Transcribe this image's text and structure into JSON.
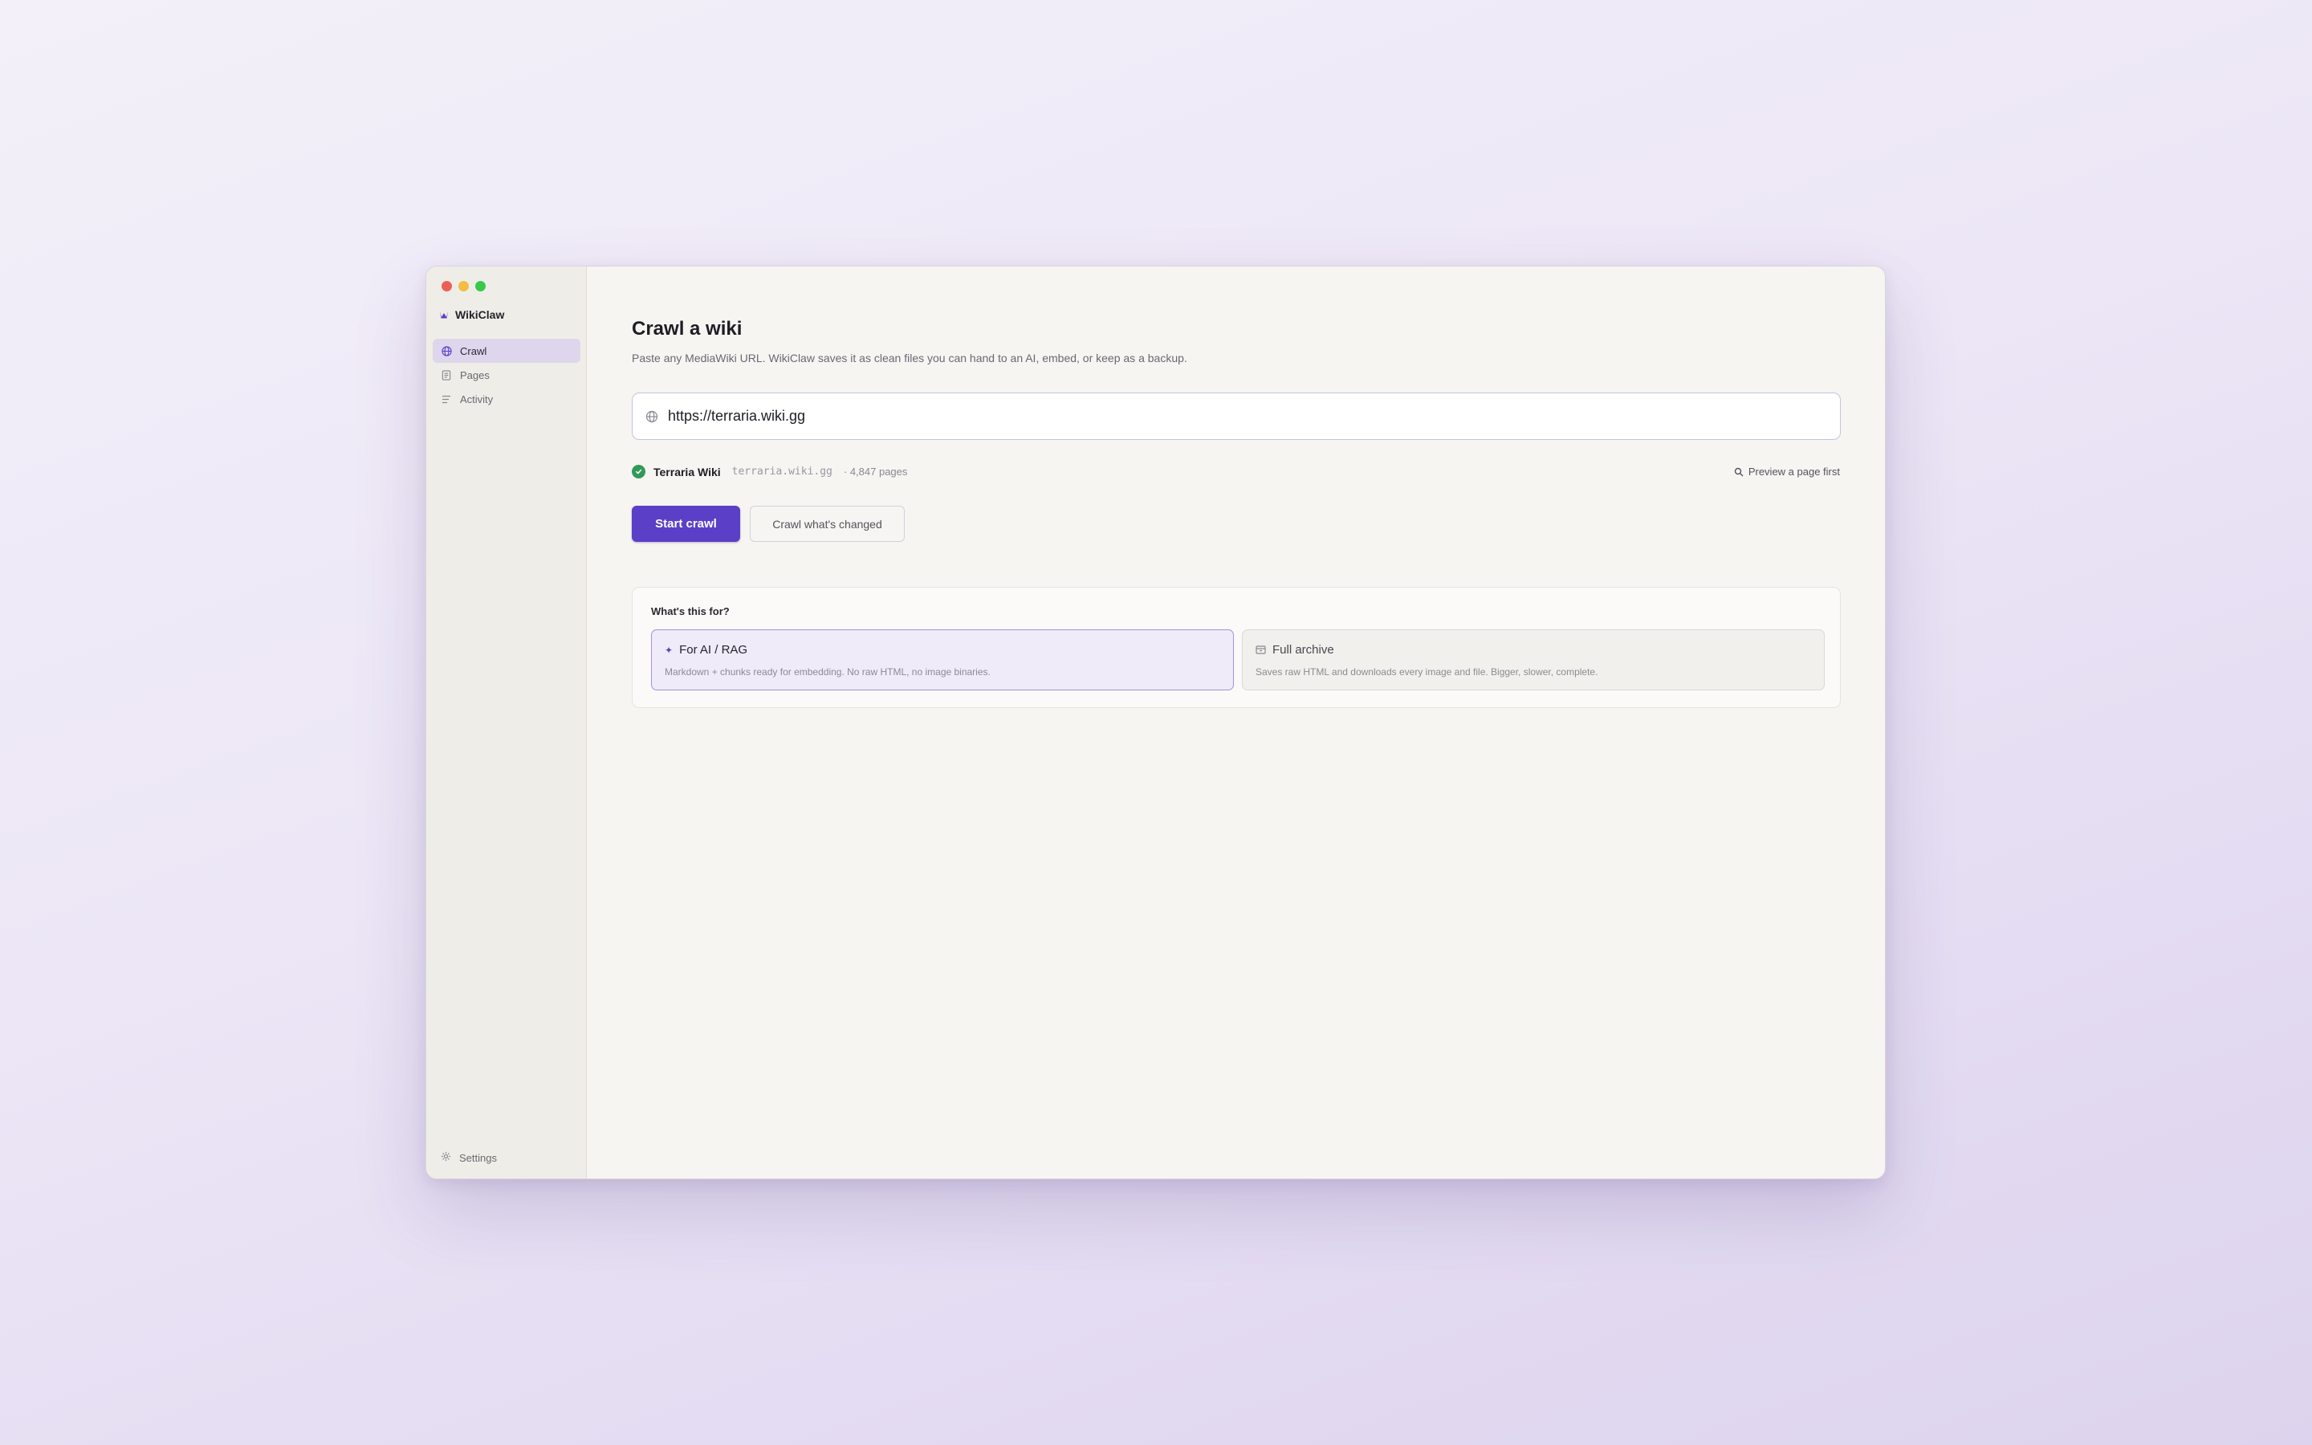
{
  "app": {
    "name": "WikiClaw"
  },
  "sidebar": {
    "items": [
      {
        "label": "Crawl",
        "icon": "globe-icon",
        "active": true
      },
      {
        "label": "Pages",
        "icon": "document-icon",
        "active": false
      },
      {
        "label": "Activity",
        "icon": "list-icon",
        "active": false
      }
    ],
    "settings_label": "Settings"
  },
  "main": {
    "title": "Crawl a wiki",
    "subtitle": "Paste any MediaWiki URL. WikiClaw saves it as clean files you can hand to an AI, embed, or keep as a backup.",
    "url_input": {
      "value": "https://terraria.wiki.gg"
    },
    "detected": {
      "name": "Terraria Wiki",
      "domain": "terraria.wiki.gg",
      "count": "· 4,847 pages"
    },
    "preview_label": "Preview a page first",
    "start_button": "Start crawl",
    "changed_button": "Crawl what's changed",
    "purpose": {
      "label": "What's this for?",
      "options": [
        {
          "title": "For AI / RAG",
          "description": "Markdown + chunks ready for embedding. No raw HTML, no image binaries.",
          "icon": "sparkle-icon",
          "selected": true
        },
        {
          "title": "Full archive",
          "description": "Saves raw HTML and downloads every image and file. Bigger, slower, complete.",
          "icon": "archive-icon",
          "selected": false
        }
      ]
    }
  },
  "colors": {
    "accent": "#5b3fc7",
    "success": "#2f9a57",
    "window_close": "#ec5f57",
    "window_minimize": "#f2bd40",
    "window_zoom": "#36c94a"
  }
}
